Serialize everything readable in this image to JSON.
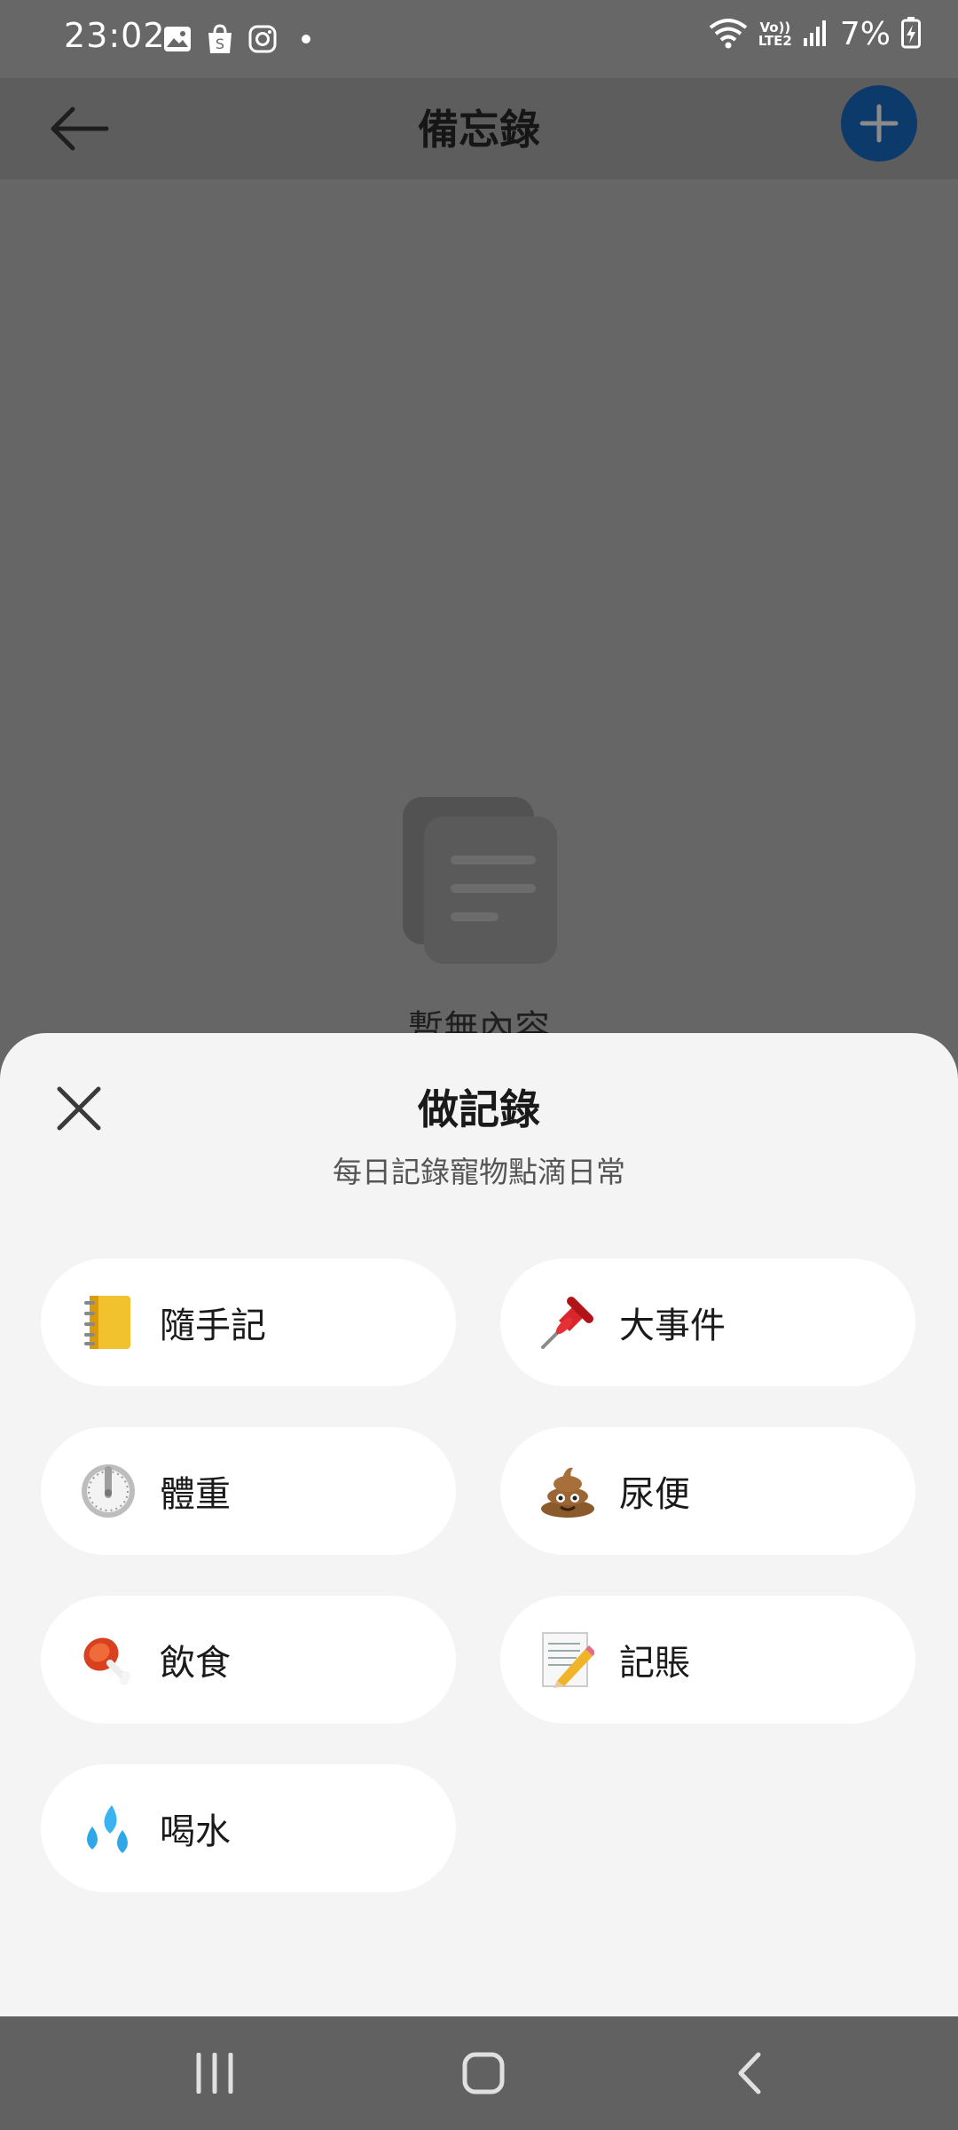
{
  "status_bar": {
    "time": "23:02",
    "left_icons": [
      "gallery-icon",
      "shopee-icon",
      "instagram-icon",
      "dot-icon"
    ],
    "network_top": "Vo))",
    "network_bottom": "LTE2",
    "battery": "7%"
  },
  "app_bar": {
    "title": "備忘錄",
    "back_icon": "arrow-left-icon",
    "add_icon": "plus-icon",
    "add_color": "#0b3a6b"
  },
  "empty_state": {
    "text": "暫無內容",
    "icon": "documents-icon"
  },
  "sheet": {
    "title": "做記錄",
    "subtitle": "每日記錄寵物點滴日常",
    "close_icon": "close-icon",
    "options": [
      {
        "label": "隨手記",
        "icon": "notebook-icon"
      },
      {
        "label": "大事件",
        "icon": "pushpin-icon"
      },
      {
        "label": "體重",
        "icon": "timer-icon"
      },
      {
        "label": "尿便",
        "icon": "poop-icon"
      },
      {
        "label": "飲食",
        "icon": "meat-icon"
      },
      {
        "label": "記賬",
        "icon": "memo-icon"
      },
      {
        "label": "喝水",
        "icon": "droplets-icon"
      }
    ]
  },
  "nav_bar": {
    "buttons": [
      "recents-icon",
      "home-icon",
      "back-icon"
    ]
  }
}
